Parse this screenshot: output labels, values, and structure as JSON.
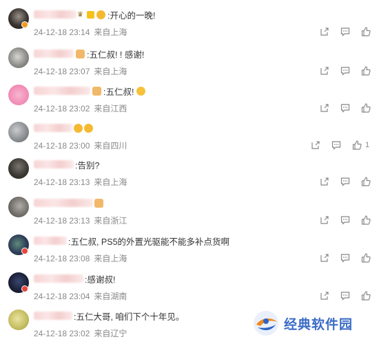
{
  "comments": [
    {
      "text": ":开心的一晚!",
      "date": "24-12-18 23:14",
      "location": "来自上海"
    },
    {
      "text": ":五仁叔! ! 感谢!",
      "date": "24-12-18 23:07",
      "location": "来自上海"
    },
    {
      "text": ":五仁叔!",
      "date": "24-12-18 23:02",
      "location": "来自江西"
    },
    {
      "text": "",
      "date": "24-12-18 23:00",
      "location": "来自四川",
      "likes": "1"
    },
    {
      "text": ":告别?",
      "date": "24-12-18 23:13",
      "location": "来自上海"
    },
    {
      "text": "",
      "date": "24-12-18 23:13",
      "location": "来自浙江"
    },
    {
      "text": ":五仁叔, PS5的外置光驱能不能多补点货啊",
      "date": "24-12-18 23:08",
      "location": "来自上海"
    },
    {
      "text": ":感谢叔!",
      "date": "24-12-18 23:04",
      "location": "来自湖南"
    },
    {
      "text": ":五仁大哥, 咱们下个十年见。",
      "date": "24-12-18 23:02",
      "location": "来自辽宁"
    }
  ],
  "icons": {
    "share": "share-icon",
    "reply": "comment-icon",
    "like": "thumbs-up-icon"
  },
  "colors": {
    "meta": "#888888",
    "text": "#333333",
    "blur": "#f6cfcf",
    "brand": "#3b6cc6"
  },
  "watermark": {
    "text": "经典软件园"
  }
}
